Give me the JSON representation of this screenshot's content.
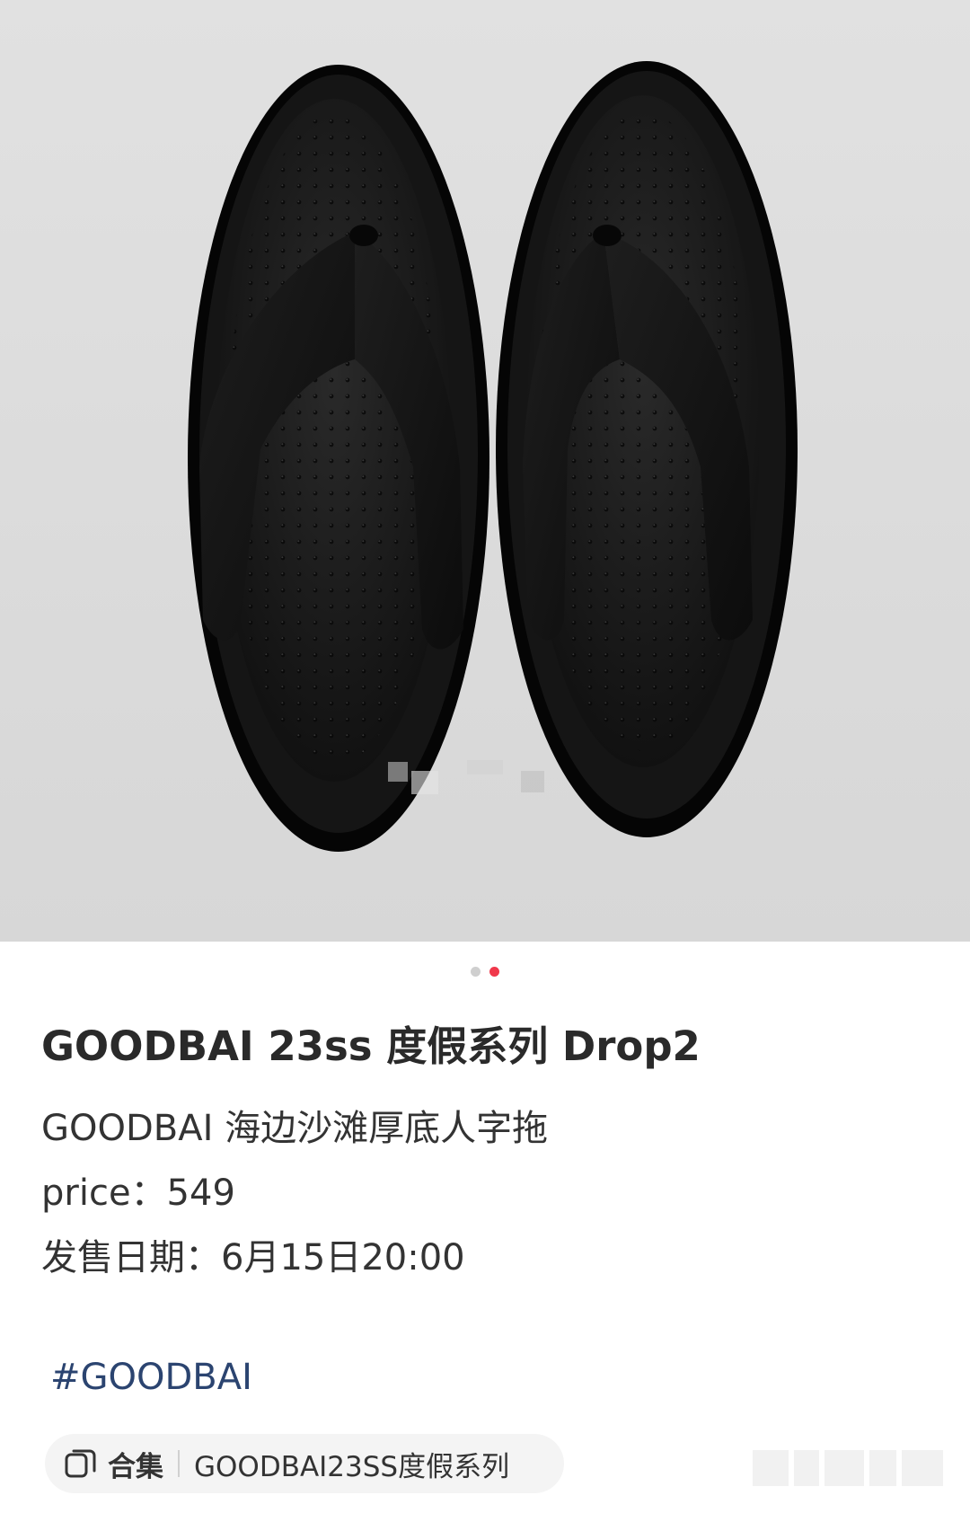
{
  "product_image": {
    "subject": "black platform thong sandals",
    "background_color": "#dcdcdc",
    "carousel": {
      "total": 2,
      "active_index": 1
    }
  },
  "post": {
    "title": "GOODBAI 23ss 度假系列 Drop2",
    "lines": [
      "GOODBAI 海边沙滩厚底人字拖",
      "price：549",
      "发售日期：6月15日20:00"
    ],
    "hashtag": "#GOODBAI"
  },
  "collection": {
    "icon": "collection-icon",
    "label": "合集",
    "name": "GOODBAI23SS度假系列"
  },
  "colors": {
    "accent_dot": "#f0384b",
    "hashtag": "#2b4470"
  }
}
